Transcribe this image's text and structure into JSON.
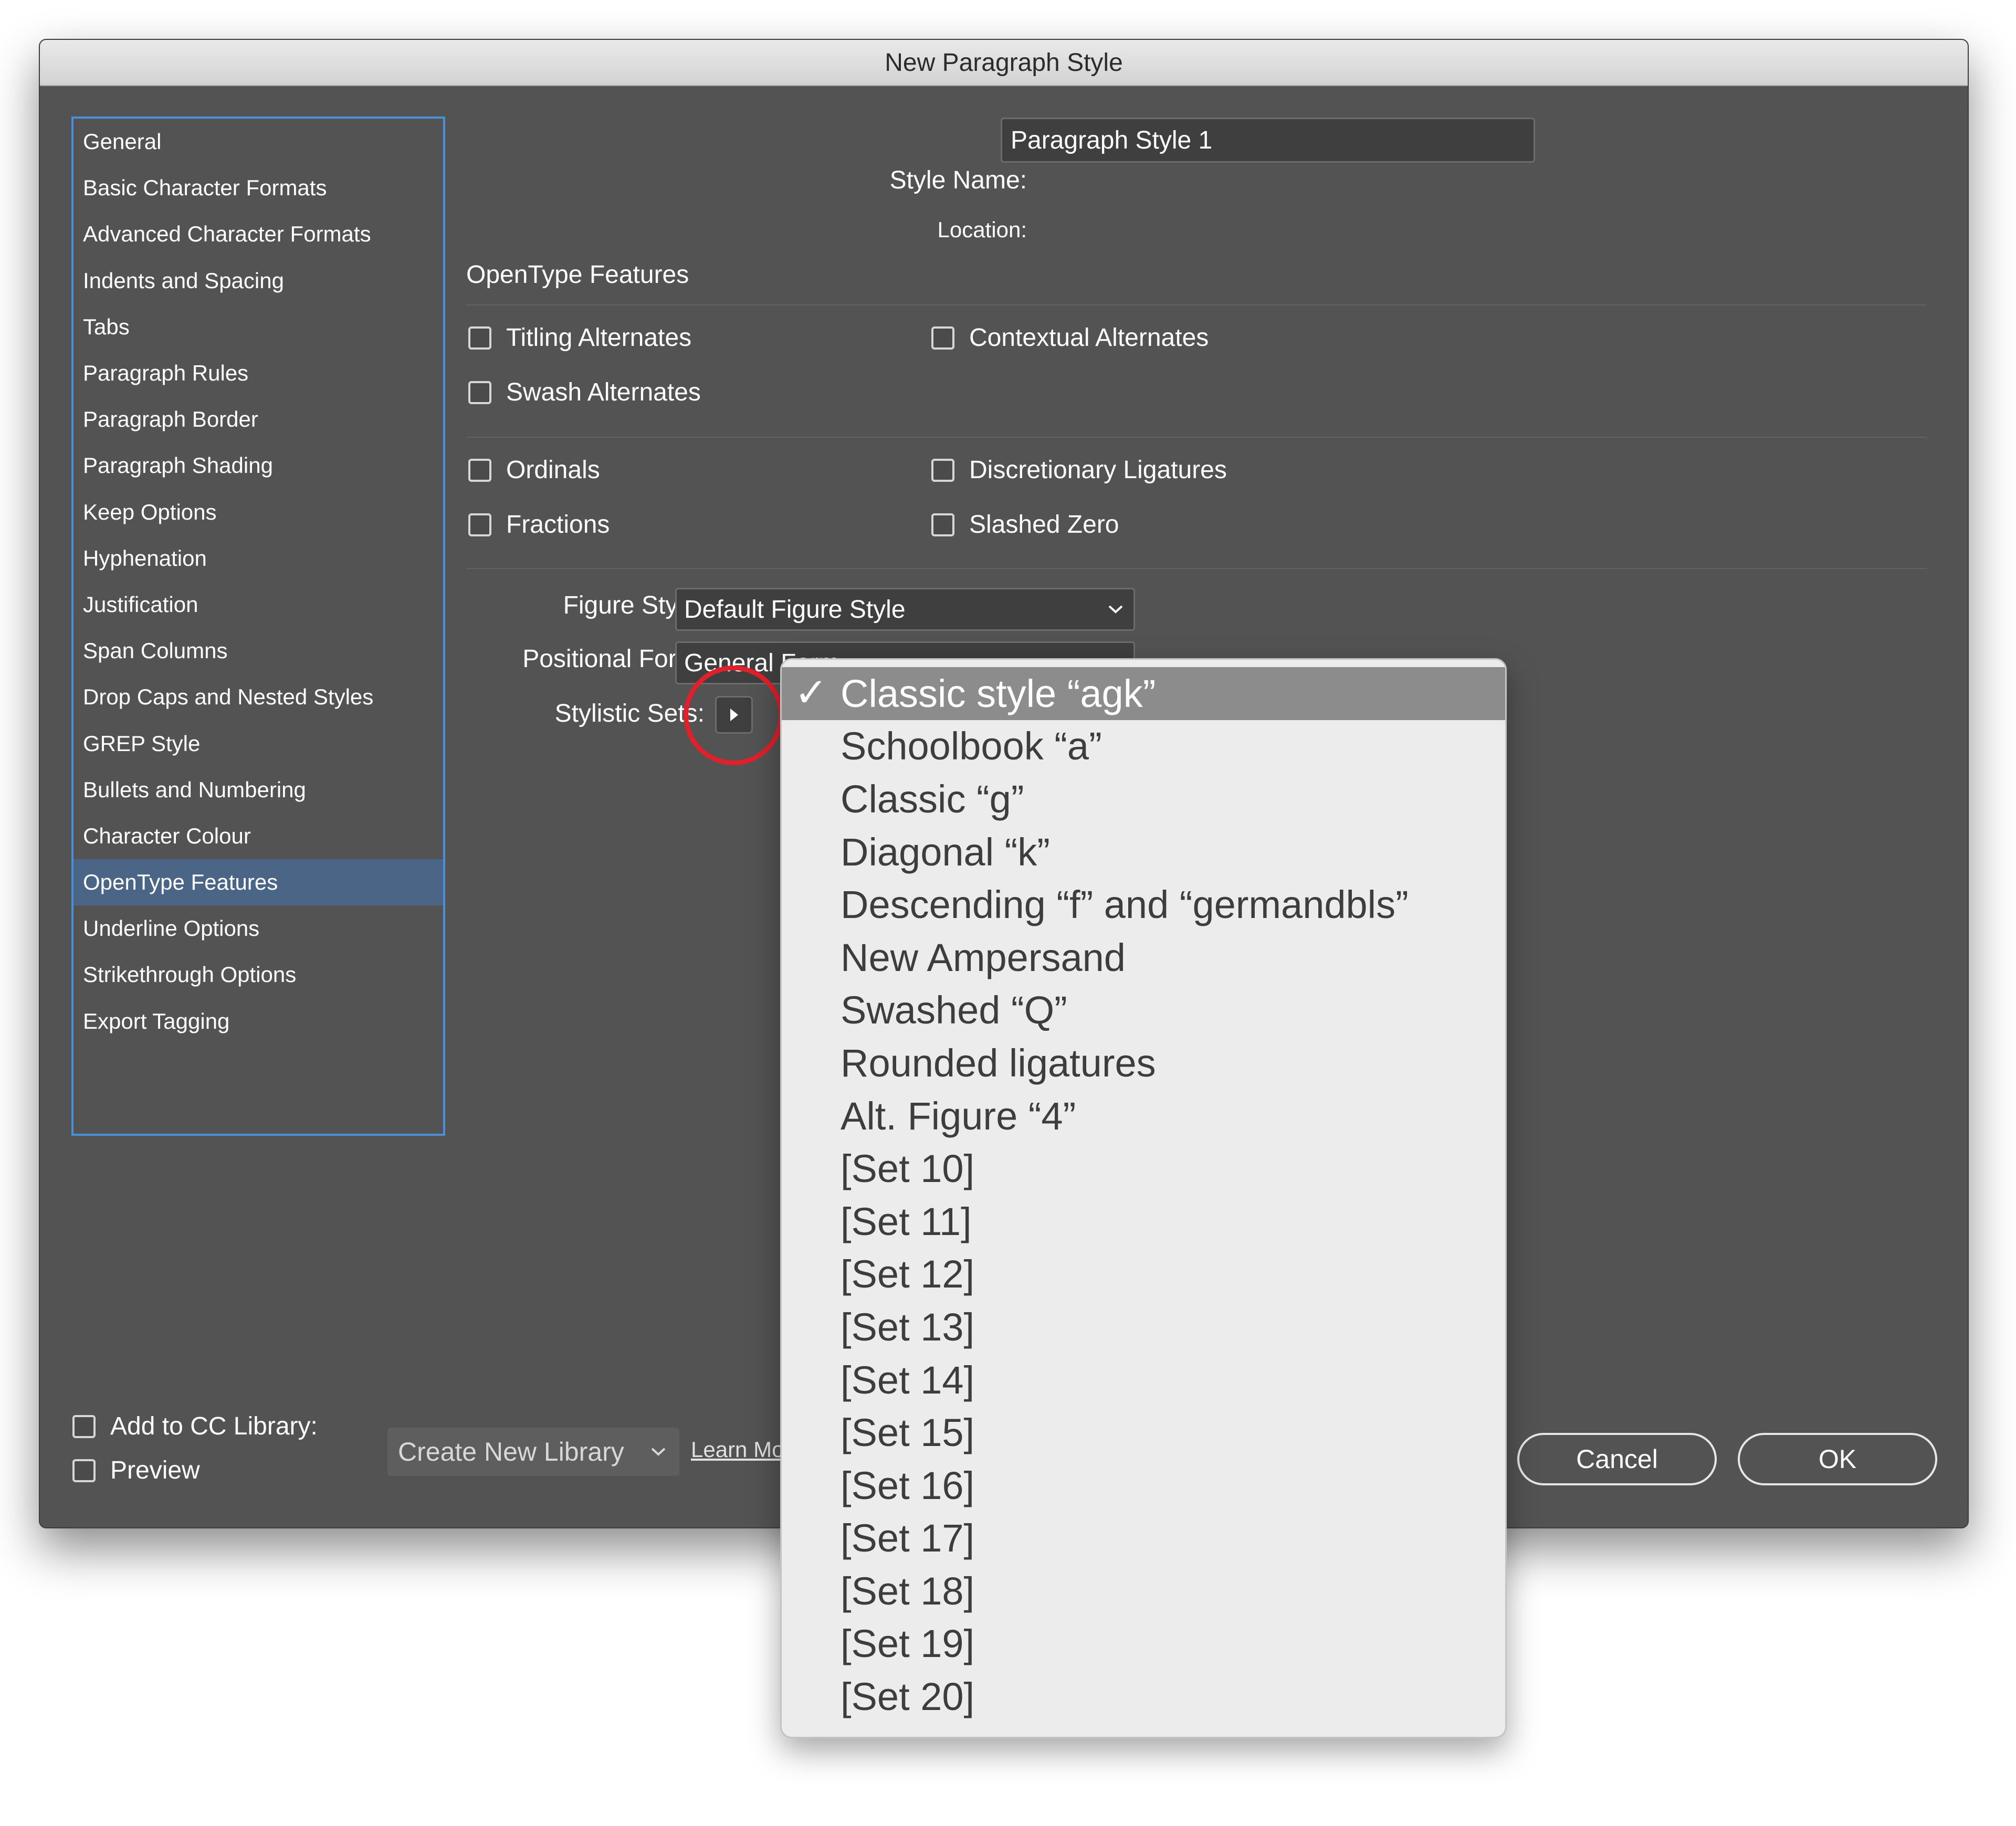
{
  "window": {
    "title": "New Paragraph Style"
  },
  "sidebar": {
    "items": [
      {
        "label": "General"
      },
      {
        "label": "Basic Character Formats"
      },
      {
        "label": "Advanced Character Formats"
      },
      {
        "label": "Indents and Spacing"
      },
      {
        "label": "Tabs"
      },
      {
        "label": "Paragraph Rules"
      },
      {
        "label": "Paragraph Border"
      },
      {
        "label": "Paragraph Shading"
      },
      {
        "label": "Keep Options"
      },
      {
        "label": "Hyphenation"
      },
      {
        "label": "Justification"
      },
      {
        "label": "Span Columns"
      },
      {
        "label": "Drop Caps and Nested Styles"
      },
      {
        "label": "GREP Style"
      },
      {
        "label": "Bullets and Numbering"
      },
      {
        "label": "Character Colour"
      },
      {
        "label": "OpenType Features",
        "active": true
      },
      {
        "label": "Underline Options"
      },
      {
        "label": "Strikethrough Options"
      },
      {
        "label": "Export Tagging"
      }
    ],
    "active_index": 16
  },
  "header": {
    "style_name_label": "Style Name:",
    "style_name_value": "Paragraph Style 1",
    "location_label": "Location:",
    "section_title": "OpenType Features"
  },
  "features": {
    "titling_alternates": {
      "label": "Titling Alternates",
      "checked": false
    },
    "contextual_alternates": {
      "label": "Contextual Alternates",
      "checked": false
    },
    "swash_alternates": {
      "label": "Swash Alternates",
      "checked": false
    },
    "ordinals": {
      "label": "Ordinals",
      "checked": false
    },
    "discretionary_ligatures": {
      "label": "Discretionary Ligatures",
      "checked": false
    },
    "fractions": {
      "label": "Fractions",
      "checked": false
    },
    "slashed_zero": {
      "label": "Slashed Zero",
      "checked": false
    }
  },
  "figure_style": {
    "label": "Figure Style:",
    "value": "Default Figure Style"
  },
  "positional_form": {
    "label": "Positional Form:",
    "value": "General Form"
  },
  "stylistic_sets": {
    "label": "Stylistic Sets:"
  },
  "popup": {
    "items": [
      {
        "label": "Classic style “agk”",
        "checked": true
      },
      {
        "label": "Schoolbook “a”"
      },
      {
        "label": "Classic “g”"
      },
      {
        "label": "Diagonal “k”"
      },
      {
        "label": "Descending “f” and “germandbls”"
      },
      {
        "label": "New Ampersand"
      },
      {
        "label": "Swashed “Q”"
      },
      {
        "label": "Rounded ligatures"
      },
      {
        "label": "Alt. Figure “4”"
      },
      {
        "label": "[Set 10]"
      },
      {
        "label": "[Set 11]"
      },
      {
        "label": "[Set 12]"
      },
      {
        "label": "[Set 13]"
      },
      {
        "label": "[Set 14]"
      },
      {
        "label": "[Set 15]"
      },
      {
        "label": "[Set 16]"
      },
      {
        "label": "[Set 17]"
      },
      {
        "label": "[Set 18]"
      },
      {
        "label": "[Set 19]"
      },
      {
        "label": "[Set 20]"
      }
    ],
    "check_glyph": "✓"
  },
  "footer": {
    "add_to_cc_label": "Add to CC Library:",
    "library_select_value": "Create New Library",
    "learn_more_label": "Learn More...",
    "preview_label": "Preview",
    "cancel_label": "Cancel",
    "ok_label": "OK"
  },
  "colors": {
    "dialog_bg": "#535353",
    "sidebar_border": "#4a90d9",
    "sidebar_active": "#4a6586",
    "popup_bg": "#ececec",
    "popup_selected": "#8c8c8c",
    "highlight_ring": "#e0202a"
  }
}
